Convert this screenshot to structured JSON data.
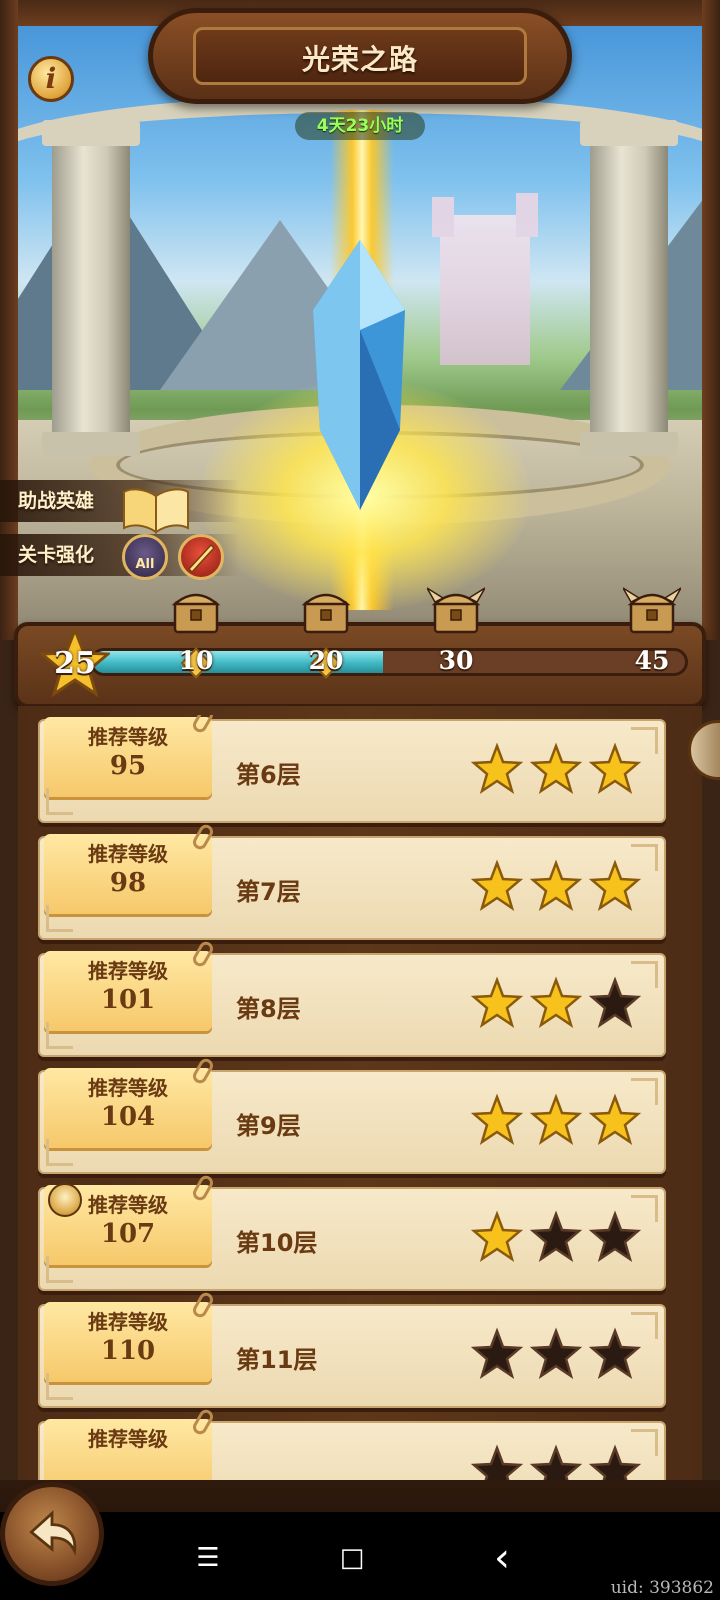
{
  "header": {
    "title": "光荣之路",
    "timer": "4天23小时",
    "info_label": "i"
  },
  "side_menu": {
    "assist_heroes": "助战英雄",
    "stage_buff": "关卡强化",
    "stage_buff_badge": "All"
  },
  "progress": {
    "current_stars": "25",
    "max": 45,
    "fill_fraction": 0.49,
    "milestones": [
      {
        "label": "10",
        "value": 10,
        "reward": "chest"
      },
      {
        "label": "20",
        "value": 20,
        "reward": "chest"
      },
      {
        "label": "30",
        "value": 30,
        "reward": "horned-chest"
      },
      {
        "label": "45",
        "value": 45,
        "reward": "horned-chest"
      }
    ]
  },
  "floors": [
    {
      "tag_title": "推荐等级",
      "level": "95",
      "floor": "第6层",
      "stars": 3,
      "boss": false
    },
    {
      "tag_title": "推荐等级",
      "level": "98",
      "floor": "第7层",
      "stars": 3,
      "boss": false
    },
    {
      "tag_title": "推荐等级",
      "level": "101",
      "floor": "第8层",
      "stars": 2,
      "boss": false
    },
    {
      "tag_title": "推荐等级",
      "level": "104",
      "floor": "第9层",
      "stars": 3,
      "boss": false
    },
    {
      "tag_title": "推荐等级",
      "level": "107",
      "floor": "第10层",
      "stars": 1,
      "boss": true
    },
    {
      "tag_title": "推荐等级",
      "level": "110",
      "floor": "第11层",
      "stars": 0,
      "boss": false
    },
    {
      "tag_title": "推荐等级",
      "level": "",
      "floor": "",
      "stars": 0,
      "boss": false
    }
  ],
  "footer": {
    "uid": "uid: 393862",
    "nav_menu": "☰",
    "nav_home": "□",
    "nav_back": "‹"
  },
  "colors": {
    "gold_star": "#f7c21c",
    "dark_star": "#2a1a12",
    "progress_fill": "#3fb8c4",
    "card_bg": "#f3e3c1"
  }
}
